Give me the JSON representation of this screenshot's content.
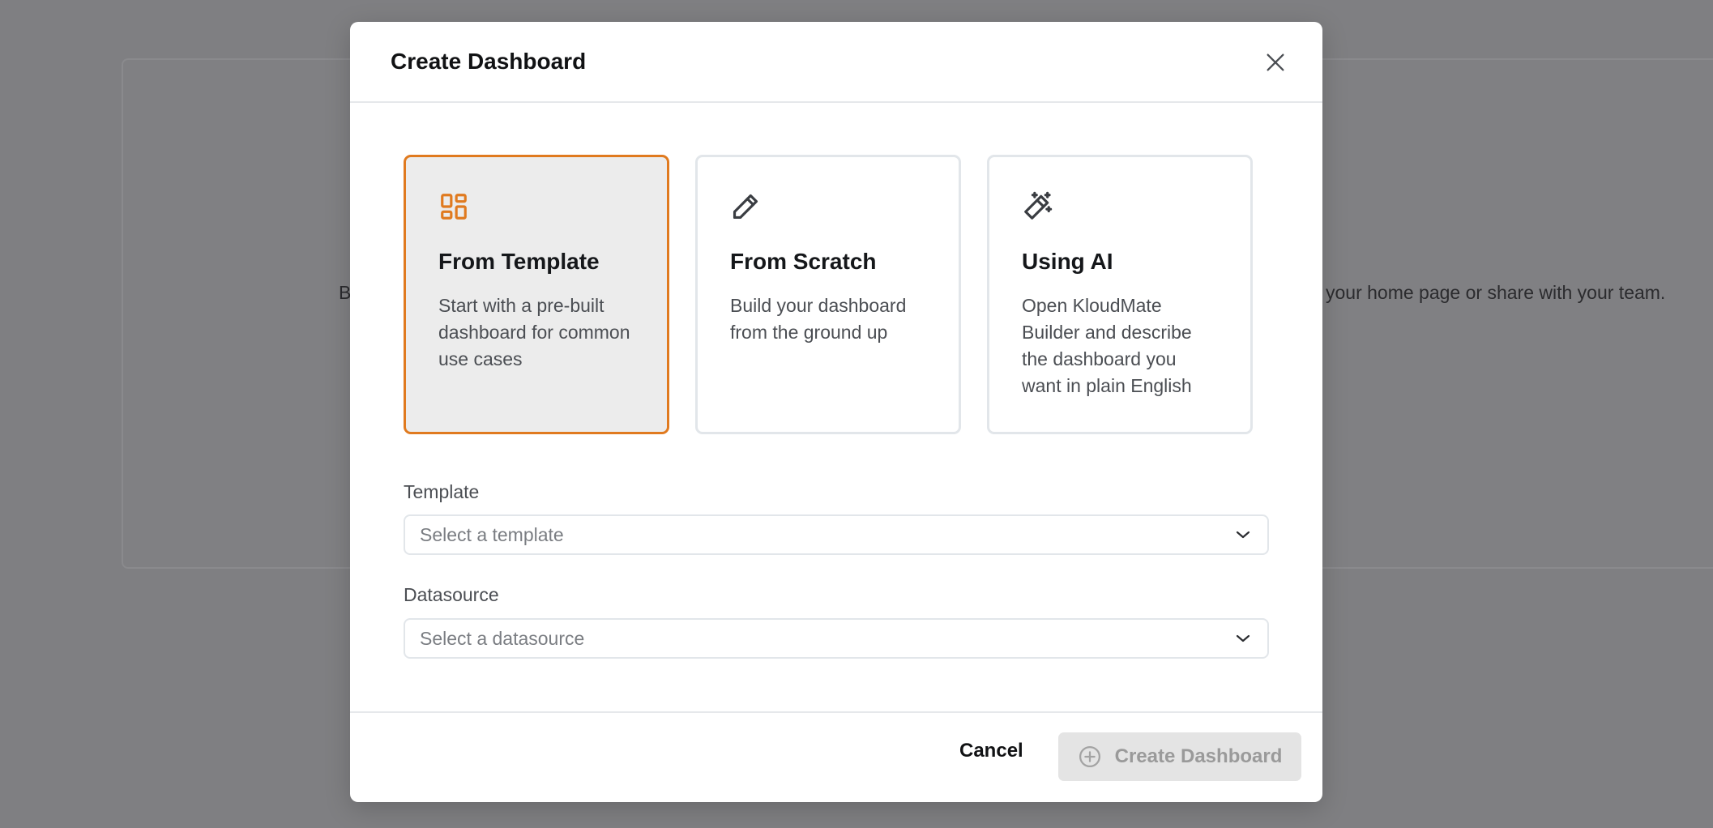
{
  "background": {
    "text_left": "B",
    "text_right": "your home page or share with your team."
  },
  "modal": {
    "title": "Create Dashboard",
    "options": [
      {
        "title": "From Template",
        "description": "Start with a pre-built dashboard for common use cases",
        "icon": "layout-grid-icon",
        "selected": true
      },
      {
        "title": "From Scratch",
        "description": "Build your dashboard from the ground up",
        "icon": "pencil-icon",
        "selected": false
      },
      {
        "title": "Using AI",
        "description": "Open KloudMate Builder and describe the dashboard you want in plain English",
        "icon": "magic-wand-icon",
        "selected": false
      }
    ],
    "template_field": {
      "label": "Template",
      "placeholder": "Select a template"
    },
    "datasource_field": {
      "label": "Datasource",
      "placeholder": "Select a datasource"
    },
    "footer": {
      "cancel_label": "Cancel",
      "create_label": "Create Dashboard"
    }
  },
  "colors": {
    "accent": "#e07a1f",
    "selected_bg": "#ececec",
    "disabled_button_bg": "#e4e4e4",
    "disabled_button_text": "#9a9a9a"
  }
}
